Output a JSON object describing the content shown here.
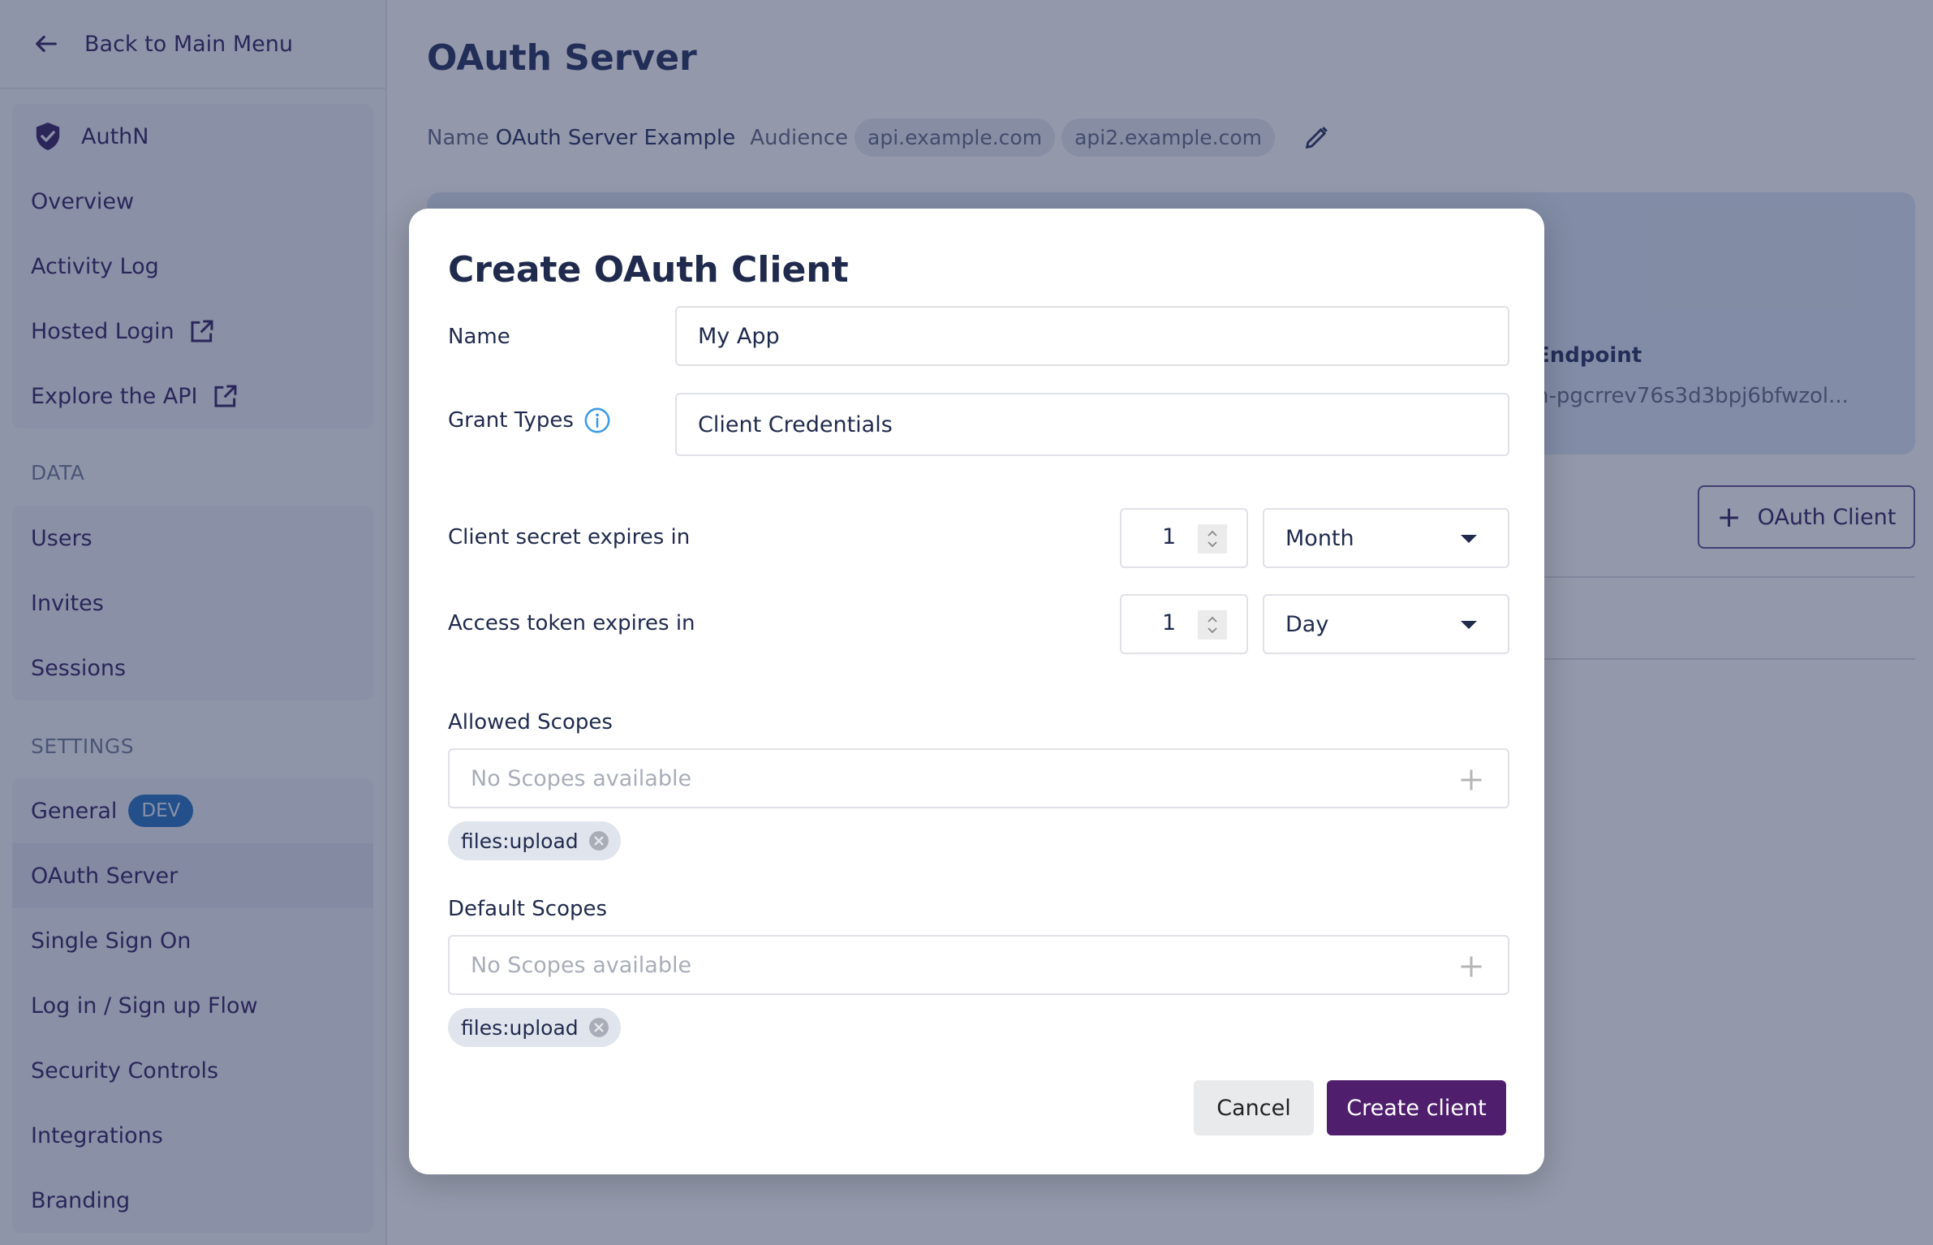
{
  "sidebar": {
    "back_label": "Back to Main Menu",
    "authn_group": {
      "title": "AuthN",
      "items": [
        {
          "label": "Overview",
          "external": false
        },
        {
          "label": "Activity Log",
          "external": false
        },
        {
          "label": "Hosted Login",
          "external": true
        },
        {
          "label": "Explore the API",
          "external": true
        }
      ]
    },
    "data_section": {
      "label": "DATA",
      "items": [
        {
          "label": "Users"
        },
        {
          "label": "Invites"
        },
        {
          "label": "Sessions"
        }
      ]
    },
    "settings_section": {
      "label": "SETTINGS",
      "items": [
        {
          "label": "General",
          "badge": "DEV"
        },
        {
          "label": "OAuth Server",
          "active": true
        },
        {
          "label": "Single Sign On"
        },
        {
          "label": "Log in / Sign up Flow"
        },
        {
          "label": "Security Controls"
        },
        {
          "label": "Integrations"
        },
        {
          "label": "Branding"
        }
      ]
    }
  },
  "main": {
    "title": "OAuth Server",
    "meta": {
      "name_key": "Name",
      "name_value": "OAuth Server Example",
      "audience_key": "Audience",
      "audiences": [
        "api.example.com",
        "api2.example.com"
      ]
    },
    "info_panel": {
      "endpoint_title": "Endpoint",
      "endpoint_value": "n-pgcrrev76s3d3bpj6bfwzol..."
    },
    "add_client_label": "OAuth Client"
  },
  "modal": {
    "title": "Create OAuth Client",
    "name_label": "Name",
    "name_value": "My App",
    "grant_types_label": "Grant Types",
    "grant_types_value": "Client Credentials",
    "secret_expiry": {
      "label": "Client secret expires in",
      "amount": "1",
      "unit": "Month"
    },
    "token_expiry": {
      "label": "Access token expires in",
      "amount": "1",
      "unit": "Day"
    },
    "allowed_scopes": {
      "label": "Allowed Scopes",
      "placeholder": "No Scopes available",
      "tags": [
        "files:upload"
      ]
    },
    "default_scopes": {
      "label": "Default Scopes",
      "placeholder": "No Scopes available",
      "tags": [
        "files:upload"
      ]
    },
    "cancel_label": "Cancel",
    "create_label": "Create client"
  },
  "colors": {
    "primary": "#4f1f6e",
    "dev_badge": "#1f6fbf",
    "info_icon": "#3b9be8"
  }
}
